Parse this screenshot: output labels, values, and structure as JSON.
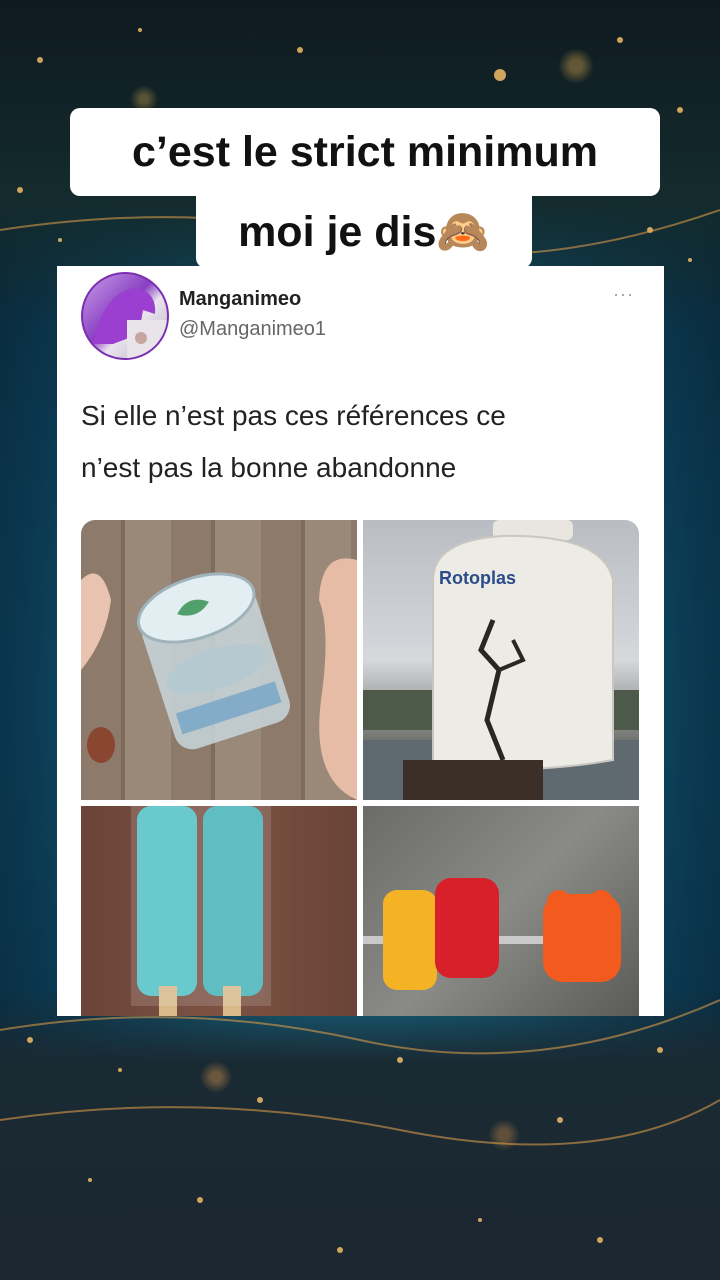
{
  "caption": {
    "line1": "c’est le strict minimum",
    "line2": "moi je dis🙈"
  },
  "tweet": {
    "display_name": "Manganimeo",
    "handle": "@Manganimeo1",
    "more_glyph": "···",
    "text_line1": "Si elle n’est pas ces références ce",
    "text_line2": "n’est pas la bonne abandonne"
  },
  "images": {
    "image1_icon": "glass-of-water-icon",
    "image2_icon": "cracked-water-tank-icon",
    "image3_icon": "popsicle-icon",
    "image4_icon": "gummy-bears-icon",
    "tank_brand": "Rotoplas"
  },
  "colors": {
    "card_bg": "#ffffff",
    "caption_bg": "#ffffff",
    "text": "#222222",
    "handle": "#666666"
  }
}
